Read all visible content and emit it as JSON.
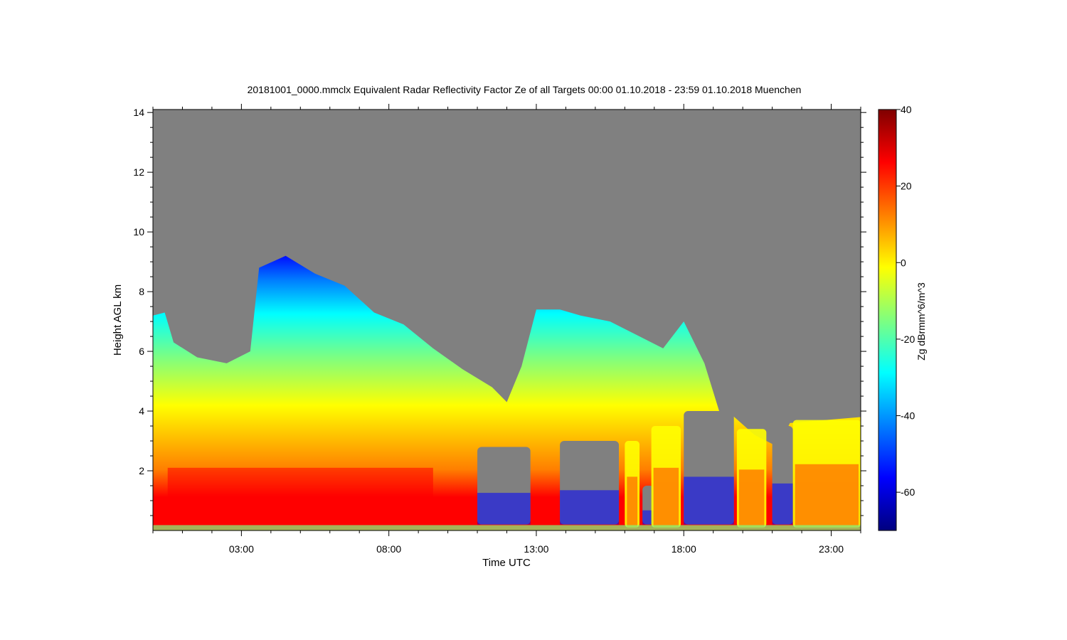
{
  "chart_data": {
    "type": "heatmap",
    "title": "20181001_0000.mmclx Equivalent Radar Reflectivity Factor Ze of all Targets   00:00 01.10.2018 - 23:59 01.10.2018 Muenchen",
    "xlabel": "Time UTC",
    "ylabel": "Height AGL km",
    "colorbar_label": "Zg dBrmm^6/m^3",
    "x_range_hours": [
      0,
      24
    ],
    "y_range_km": [
      0,
      14.1
    ],
    "x_ticks": [
      {
        "value": 3,
        "label": "03:00"
      },
      {
        "value": 8,
        "label": "08:00"
      },
      {
        "value": 13,
        "label": "13:00"
      },
      {
        "value": 18,
        "label": "18:00"
      },
      {
        "value": 23,
        "label": "23:00"
      }
    ],
    "y_ticks": [
      {
        "value": 2,
        "label": "2"
      },
      {
        "value": 4,
        "label": "4"
      },
      {
        "value": 6,
        "label": "6"
      },
      {
        "value": 8,
        "label": "8"
      },
      {
        "value": 10,
        "label": "10"
      },
      {
        "value": 12,
        "label": "12"
      },
      {
        "value": 14,
        "label": "14"
      }
    ],
    "colorbar_range": [
      -70,
      40
    ],
    "colorbar_ticks": [
      {
        "value": 40,
        "label": "40"
      },
      {
        "value": 20,
        "label": "20"
      },
      {
        "value": 0,
        "label": "0"
      },
      {
        "value": -20,
        "label": "-20"
      },
      {
        "value": -40,
        "label": "-40"
      },
      {
        "value": -60,
        "label": "-60"
      }
    ],
    "colors": {
      "no_data": "#808080",
      "colormap": [
        "#00007f",
        "#0000ff",
        "#007fff",
        "#00ffff",
        "#7fff7f",
        "#ffff00",
        "#ff7f00",
        "#ff0000",
        "#7f0000"
      ]
    },
    "echo_top_km": [
      {
        "t": 0.0,
        "h": 7.2
      },
      {
        "t": 0.4,
        "h": 7.3
      },
      {
        "t": 0.7,
        "h": 6.3
      },
      {
        "t": 1.5,
        "h": 5.8
      },
      {
        "t": 2.5,
        "h": 5.6
      },
      {
        "t": 3.3,
        "h": 6.0
      },
      {
        "t": 3.6,
        "h": 8.8
      },
      {
        "t": 4.5,
        "h": 9.2
      },
      {
        "t": 5.5,
        "h": 8.6
      },
      {
        "t": 6.5,
        "h": 8.2
      },
      {
        "t": 7.5,
        "h": 7.3
      },
      {
        "t": 8.5,
        "h": 6.9
      },
      {
        "t": 9.5,
        "h": 6.1
      },
      {
        "t": 10.5,
        "h": 5.4
      },
      {
        "t": 11.5,
        "h": 4.8
      },
      {
        "t": 12.0,
        "h": 4.3
      },
      {
        "t": 12.5,
        "h": 5.5
      },
      {
        "t": 13.0,
        "h": 7.4
      },
      {
        "t": 13.8,
        "h": 7.4
      },
      {
        "t": 14.5,
        "h": 7.2
      },
      {
        "t": 15.5,
        "h": 7.0
      },
      {
        "t": 16.3,
        "h": 6.6
      },
      {
        "t": 17.3,
        "h": 6.1
      },
      {
        "t": 18.0,
        "h": 7.0
      },
      {
        "t": 18.7,
        "h": 5.6
      },
      {
        "t": 19.2,
        "h": 4.0
      },
      {
        "t": 19.6,
        "h": 3.9
      },
      {
        "t": 20.4,
        "h": 3.2
      },
      {
        "t": 21.2,
        "h": 2.8
      },
      {
        "t": 21.6,
        "h": 3.6
      },
      {
        "t": 24.0,
        "h": 3.8
      }
    ],
    "low_level_max_band_km": [
      0.4,
      2.1
    ],
    "low_level_max_band_hours": [
      0.5,
      9.5
    ],
    "echo_gaps": [
      {
        "t_start": 11.0,
        "t_end": 12.8,
        "h_top": 2.8
      },
      {
        "t_start": 13.8,
        "t_end": 15.8,
        "h_top": 3.0
      },
      {
        "t_start": 16.6,
        "t_end": 17.0,
        "h_top": 1.5
      },
      {
        "t_start": 18.0,
        "t_end": 19.7,
        "h_top": 4.0
      },
      {
        "t_start": 21.0,
        "t_end": 21.7,
        "h_top": 3.5
      }
    ],
    "columns": [
      {
        "t_start": 16.0,
        "t_end": 16.5,
        "h_top": 3.0
      },
      {
        "t_start": 16.9,
        "t_end": 17.9,
        "h_top": 3.5
      },
      {
        "t_start": 19.8,
        "t_end": 20.8,
        "h_top": 3.4
      },
      {
        "t_start": 21.7,
        "t_end": 24.0,
        "h_top": 3.7
      }
    ]
  }
}
